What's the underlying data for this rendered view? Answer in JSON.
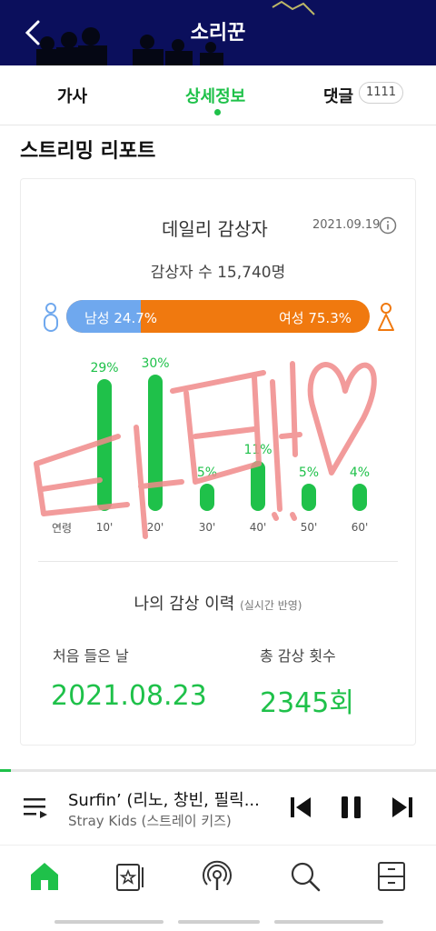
{
  "header": {
    "title": "소리꾼"
  },
  "tabs": [
    {
      "label": "가사"
    },
    {
      "label": "상세정보"
    },
    {
      "label": "댓글"
    }
  ],
  "comment_count": "1111",
  "section_title": "스트리밍 리포트",
  "daily": {
    "title": "데일리 감상자",
    "date": "2021.09.19",
    "listeners": "감상자 수 15,740명",
    "male_label": "남성 24.7%",
    "female_label": "여성 75.3%",
    "male_share": 0.247,
    "age_axis_label": "연령"
  },
  "chart_data": {
    "type": "bar",
    "categories": [
      "10'",
      "20'",
      "30'",
      "40'",
      "50'",
      "60'"
    ],
    "values": [
      29,
      30,
      5,
      11,
      5,
      4
    ],
    "value_labels": [
      "29%",
      "30%",
      "5%",
      "11%",
      "5%",
      "4%"
    ],
    "bar_color": "#1fc14a"
  },
  "history": {
    "title": "나의 감상 이력",
    "subtitle": "(실시간 반영)",
    "first_label": "처음 들은 날",
    "first_value": "2021.08.23",
    "total_label": "총 감상 횟수",
    "total_value": "2345회"
  },
  "player": {
    "title": "Surfin’ (리노, 창빈, 필릭...",
    "artist": "Stray Kids (스트레이 키즈)",
    "progress": 0.025
  },
  "nav": [
    "home-icon",
    "storage-icon",
    "podcast-icon",
    "search-icon",
    "drawer-icon"
  ],
  "colors": {
    "accent": "#1fc14a",
    "male": "#6fa8ee",
    "female": "#f0790f",
    "header_bg": "#0b0f5c",
    "scribble": "#f08a8a"
  }
}
